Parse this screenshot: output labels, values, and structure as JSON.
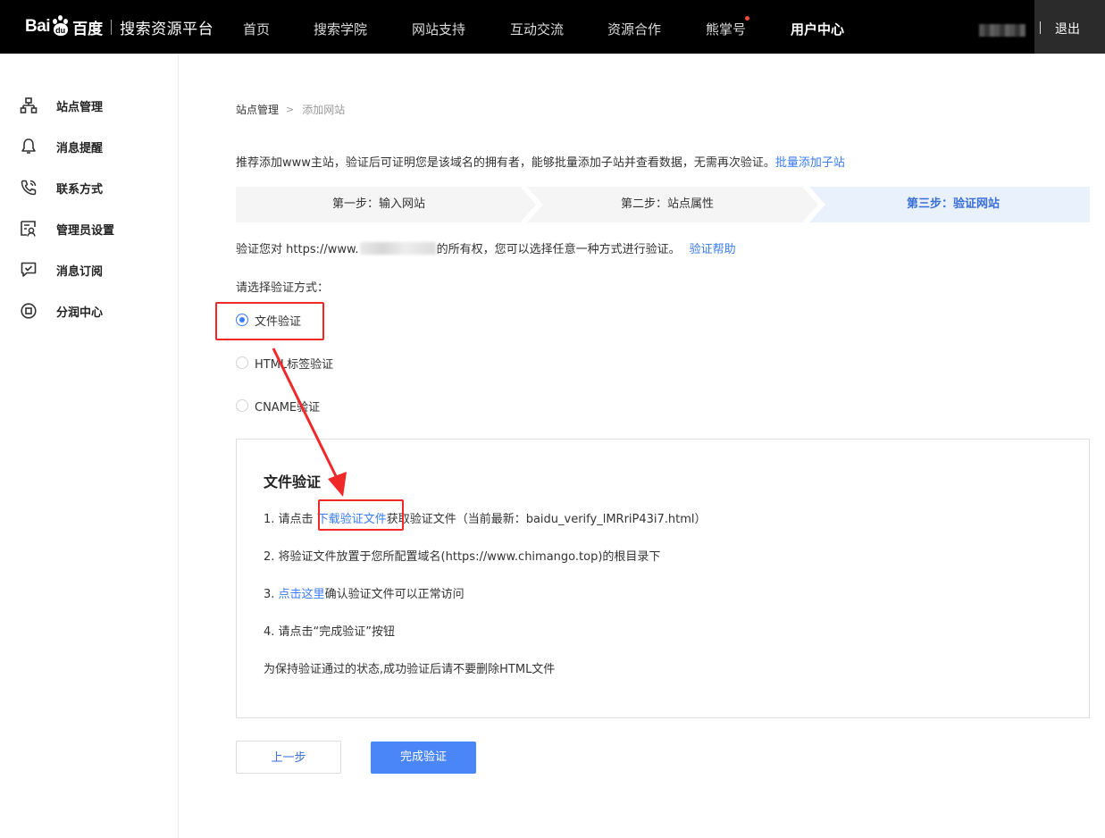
{
  "header": {
    "logo": {
      "latin": "Bai",
      "paw_text": "du",
      "chinese": "百度",
      "platform": "搜索资源平台"
    },
    "nav": [
      {
        "label": "首页",
        "active": false,
        "dot": false
      },
      {
        "label": "搜索学院",
        "active": false,
        "dot": false
      },
      {
        "label": "网站支持",
        "active": false,
        "dot": false
      },
      {
        "label": "互动交流",
        "active": false,
        "dot": false
      },
      {
        "label": "资源合作",
        "active": false,
        "dot": false
      },
      {
        "label": "熊掌号",
        "active": false,
        "dot": true
      },
      {
        "label": "用户中心",
        "active": true,
        "dot": false
      }
    ],
    "logout": "退出"
  },
  "sidebar": {
    "items": [
      {
        "label": "站点管理",
        "icon": "sitemap-icon"
      },
      {
        "label": "消息提醒",
        "icon": "bell-icon"
      },
      {
        "label": "联系方式",
        "icon": "phone-icon"
      },
      {
        "label": "管理员设置",
        "icon": "admin-icon"
      },
      {
        "label": "消息订阅",
        "icon": "subscribe-icon"
      },
      {
        "label": "分润中心",
        "icon": "revenue-icon"
      }
    ]
  },
  "breadcrumb": {
    "parent": "站点管理",
    "separator": ">",
    "current": "添加网站"
  },
  "intro": {
    "text": "推荐添加www主站，验证后可证明您是该域名的拥有者，能够批量添加子站并查看数据，无需再次验证。",
    "link": "批量添加子站"
  },
  "steps": [
    {
      "label": "第一步：输入网站",
      "active": false
    },
    {
      "label": "第二步：站点属性",
      "active": false
    },
    {
      "label": "第三步：验证网站",
      "active": true
    }
  ],
  "verify": {
    "prefix": "验证您对 https://www.",
    "suffix": "的所有权，您可以选择任意一种方式进行验证。",
    "help_link": "验证帮助"
  },
  "choose_label": "请选择验证方式：",
  "methods": [
    {
      "label": "文件验证",
      "checked": true
    },
    {
      "label": "HTML标签验证",
      "checked": false
    },
    {
      "label": "CNAME验证",
      "checked": false
    }
  ],
  "panel": {
    "title": "文件验证",
    "step1": {
      "pre": "1. 请点击",
      "link": "下载验证文件",
      "post": "获取验证文件（当前最新：baidu_verify_lMRriP43i7.html）"
    },
    "step2": "2. 将验证文件放置于您所配置域名(https://www.chimango.top)的根目录下",
    "step3": {
      "pre": "3. ",
      "link": "点击这里",
      "post": "确认验证文件可以正常访问"
    },
    "step4": "4. 请点击“完成验证”按钮",
    "note": "为保持验证通过的状态,成功验证后请不要删除HTML文件"
  },
  "buttons": {
    "prev": "上一步",
    "done": "完成验证"
  },
  "colors": {
    "accent": "#3a7bf5",
    "highlight": "#f02828",
    "active_step_bg": "#e9f1fd",
    "step_bg": "#f5f5f5"
  }
}
